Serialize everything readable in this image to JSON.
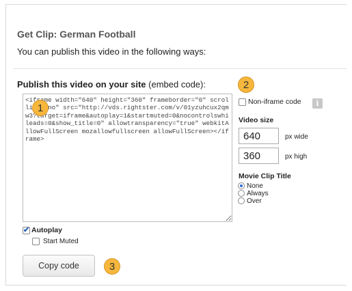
{
  "header": {
    "title": "Get Clip: German Football",
    "subtitle": "You can publish this video in the following ways:"
  },
  "publish": {
    "heading_bold": "Publish this video on your site",
    "heading_suffix": " (embed code):",
    "embed_code": "<iframe width=\"640\" height=\"360\" frameborder=\"0\" scrolling=\"no\" src=\"http://vds.rightster.com/v/01yzuhcux2qmw3?target=iframe&autoplay=1&startmuted=0&nocontrolswhileads=0&show_title=0\" allowtransparency=\"true\" webkitAllowFullScreen mozallowfullscreen allowFullScreen></iframe>"
  },
  "callouts": [
    "1",
    "2",
    "3"
  ],
  "callout_color": "#f6b73c",
  "options": {
    "non_iframe_label": "Non-iframe code",
    "non_iframe_checked": false,
    "info_icon": "info-icon",
    "video_size_label": "Video size",
    "width_value": "640",
    "width_unit": "px wide",
    "height_value": "360",
    "height_unit": "px high",
    "movie_title_label": "Movie Clip Title",
    "title_options": [
      {
        "label": "None",
        "selected": true
      },
      {
        "label": "Always",
        "selected": false
      },
      {
        "label": "Over",
        "selected": false
      }
    ]
  },
  "playback": {
    "autoplay_label": "Autoplay",
    "autoplay_checked": true,
    "start_muted_label": "Start Muted",
    "start_muted_checked": false
  },
  "actions": {
    "copy_label": "Copy code"
  }
}
